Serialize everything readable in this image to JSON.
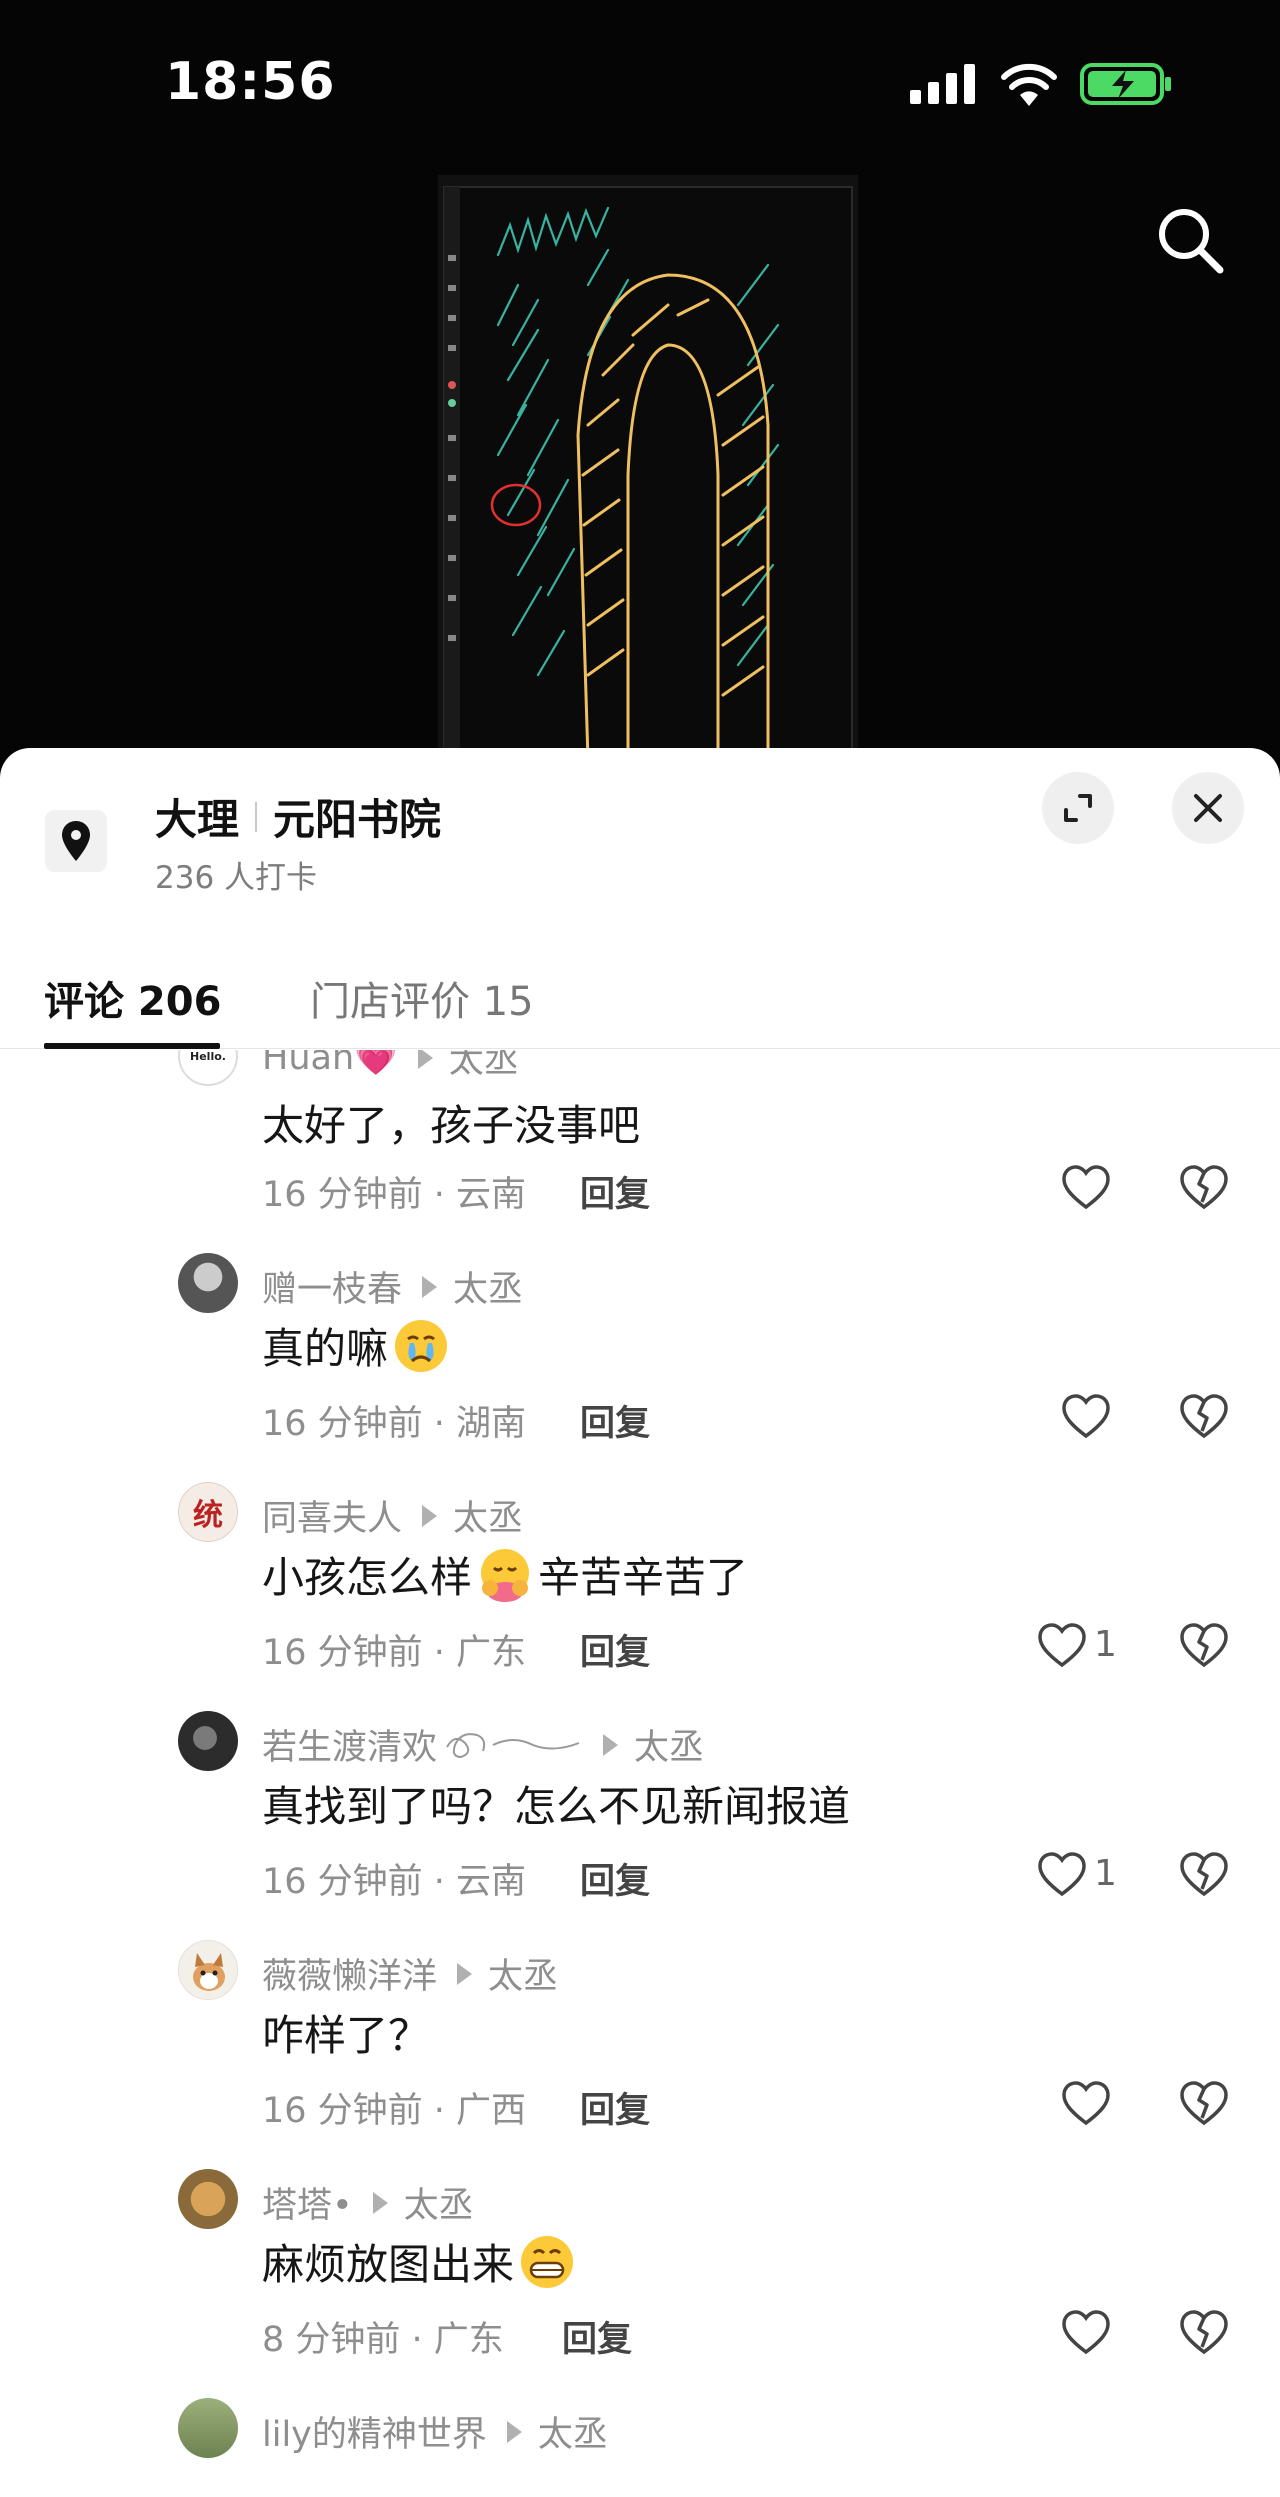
{
  "status_bar": {
    "time": "18:56"
  },
  "location": {
    "city": "大理",
    "place": "元阳书院",
    "checkins": "236 人打卡"
  },
  "tabs": [
    {
      "label": "评论 206",
      "active": true
    },
    {
      "label": "门店评价 15",
      "active": false
    }
  ],
  "reply_label": "回复",
  "target_user": "太丞",
  "comments": [
    {
      "user": "Huan💗",
      "avatar": "hello-avatar",
      "text": "太好了，孩子没事吧",
      "emoji": "",
      "meta": "16 分钟前 · 云南",
      "likes": ""
    },
    {
      "user": "赠一枝春",
      "avatar": "person-avatar",
      "text": "真的嘛",
      "emoji": "crying-face",
      "meta": "16 分钟前 · 湖南",
      "likes": ""
    },
    {
      "user": "同喜夫人",
      "avatar": "calligraphy-avatar",
      "text": "小孩怎么样",
      "emoji": "hug-face",
      "text_after": "辛苦辛苦了",
      "meta": "16 分钟前 · 广东",
      "likes": "1"
    },
    {
      "user": "若生渡清欢",
      "avatar": "dark-avatar",
      "text": "真找到了吗？怎么不见新闻报道",
      "emoji": "",
      "meta": "16 分钟前 · 云南",
      "likes": "1"
    },
    {
      "user": "薇薇懒洋洋",
      "avatar": "dog-avatar",
      "text": "咋样了？",
      "emoji": "",
      "meta": "16 分钟前 · 广西",
      "likes": ""
    },
    {
      "user": "塔塔•",
      "avatar": "golden-dog-avatar",
      "text": "麻烦放图出来",
      "emoji": "grin-face",
      "meta": "8 分钟前 · 广东",
      "likes": ""
    },
    {
      "user": "lily的精神世界",
      "avatar": "landscape-avatar",
      "text": "",
      "emoji": "",
      "meta": "",
      "likes": ""
    }
  ],
  "colors": {
    "accent": "#111111",
    "muted": "#8e8e8e",
    "battery": "#4cd964"
  }
}
